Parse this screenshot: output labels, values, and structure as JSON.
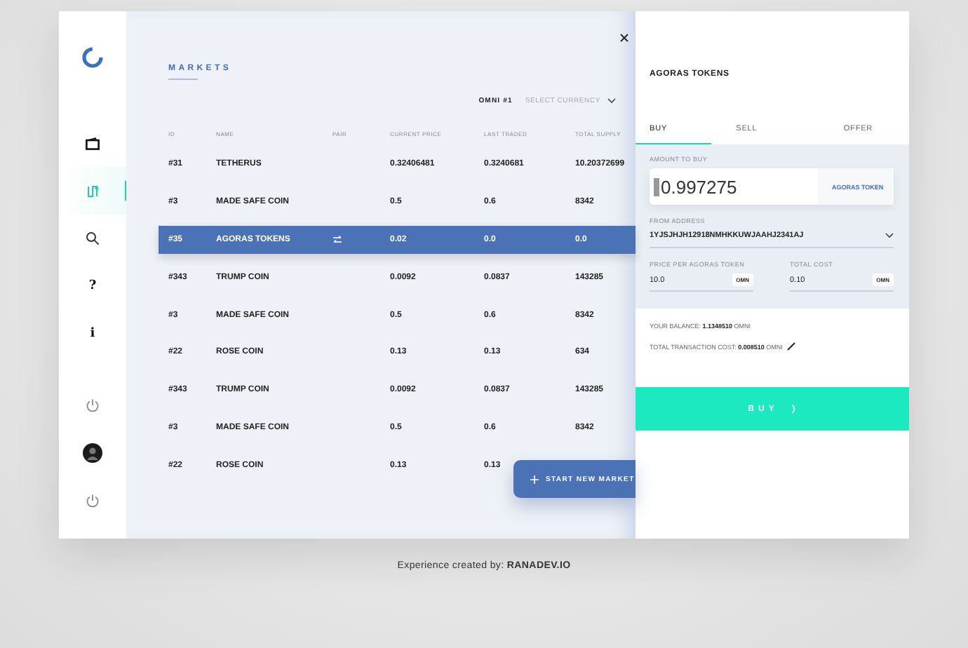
{
  "sidebar": {
    "items": [
      {
        "kind": "logo"
      },
      {
        "kind": "wallet",
        "selected": false
      },
      {
        "kind": "exchange",
        "selected": true
      },
      {
        "kind": "search",
        "selected": false
      },
      {
        "kind": "text",
        "label": "?",
        "selected": false
      },
      {
        "kind": "text",
        "label": "i",
        "selected": false
      },
      {
        "kind": "power",
        "selected": false
      },
      {
        "kind": "avatar",
        "selected": false
      },
      {
        "kind": "power",
        "selected": false
      }
    ]
  },
  "markets": {
    "title": "MARKETS",
    "network": "OMNI #1",
    "currency_select": {
      "placeholder": "SELECT CURRENCY"
    },
    "table": {
      "columns": [
        "ID",
        "NAME",
        "PAIR",
        "CURRENT PRICE",
        "LAST TRADED",
        "TOTAL SUPPLY"
      ],
      "rows": [
        {
          "id": "#31",
          "name": "TETHERUS",
          "pair": false,
          "price": "0.32406481",
          "last": "0.3240681",
          "supply": "10.20372699",
          "selected": false
        },
        {
          "id": "#3",
          "name": "MADE SAFE COIN",
          "pair": false,
          "price": "0.5",
          "last": "0.6",
          "supply": "8342",
          "selected": false
        },
        {
          "id": "#35",
          "name": "AGORAS TOKENS",
          "pair": true,
          "price": "0.02",
          "last": "0.0",
          "supply": "0.0",
          "selected": true
        },
        {
          "id": "#343",
          "name": "TRUMP COIN",
          "pair": false,
          "price": "0.0092",
          "last": "0.0837",
          "supply": "143285",
          "selected": false
        },
        {
          "id": "#3",
          "name": "MADE SAFE COIN",
          "pair": false,
          "price": "0.5",
          "last": "0.6",
          "supply": "8342",
          "selected": false
        },
        {
          "id": "#22",
          "name": "ROSE COIN",
          "pair": false,
          "price": "0.13",
          "last": "0.13",
          "supply": "634",
          "selected": false
        },
        {
          "id": "#343",
          "name": "TRUMP COIN",
          "pair": false,
          "price": "0.0092",
          "last": "0.0837",
          "supply": "143285",
          "selected": false
        },
        {
          "id": "#3",
          "name": "MADE SAFE COIN",
          "pair": false,
          "price": "0.5",
          "last": "0.6",
          "supply": "8342",
          "selected": false
        },
        {
          "id": "#22",
          "name": "ROSE COIN",
          "pair": false,
          "price": "0.13",
          "last": "0.13",
          "selected": false
        }
      ]
    },
    "new_market_button": "START NEW MARKET"
  },
  "panel": {
    "title": "AGORAS TOKENS",
    "tabs": [
      {
        "label": "BUY",
        "selected": true
      },
      {
        "label": "SELL",
        "selected": false
      },
      {
        "label": "OFFER",
        "selected": false
      }
    ],
    "amount": {
      "label": "AMOUNT TO BUY",
      "value": "0.997275",
      "unit": "AGORAS TOKEN"
    },
    "from_address": {
      "label": "FROM ADDRESS",
      "value": "1YJSJHJH12918NMHKKUWJAAHJ2341AJ"
    },
    "price": {
      "label": "PRICE PER AGORAS TOKEN",
      "value": "10.0",
      "unit": "OMN"
    },
    "total": {
      "label": "TOTAL COST",
      "value": "0.10",
      "unit": "OMN"
    },
    "balance": "YOUR BALANCE: **1.1348510** OMNI",
    "transaction_cost": "TOTAL TRANSACTION COST: **0.008510** OMNI",
    "buy_button": "BUY"
  },
  "footer": "Experience created by: **RANADEV.IO**"
}
